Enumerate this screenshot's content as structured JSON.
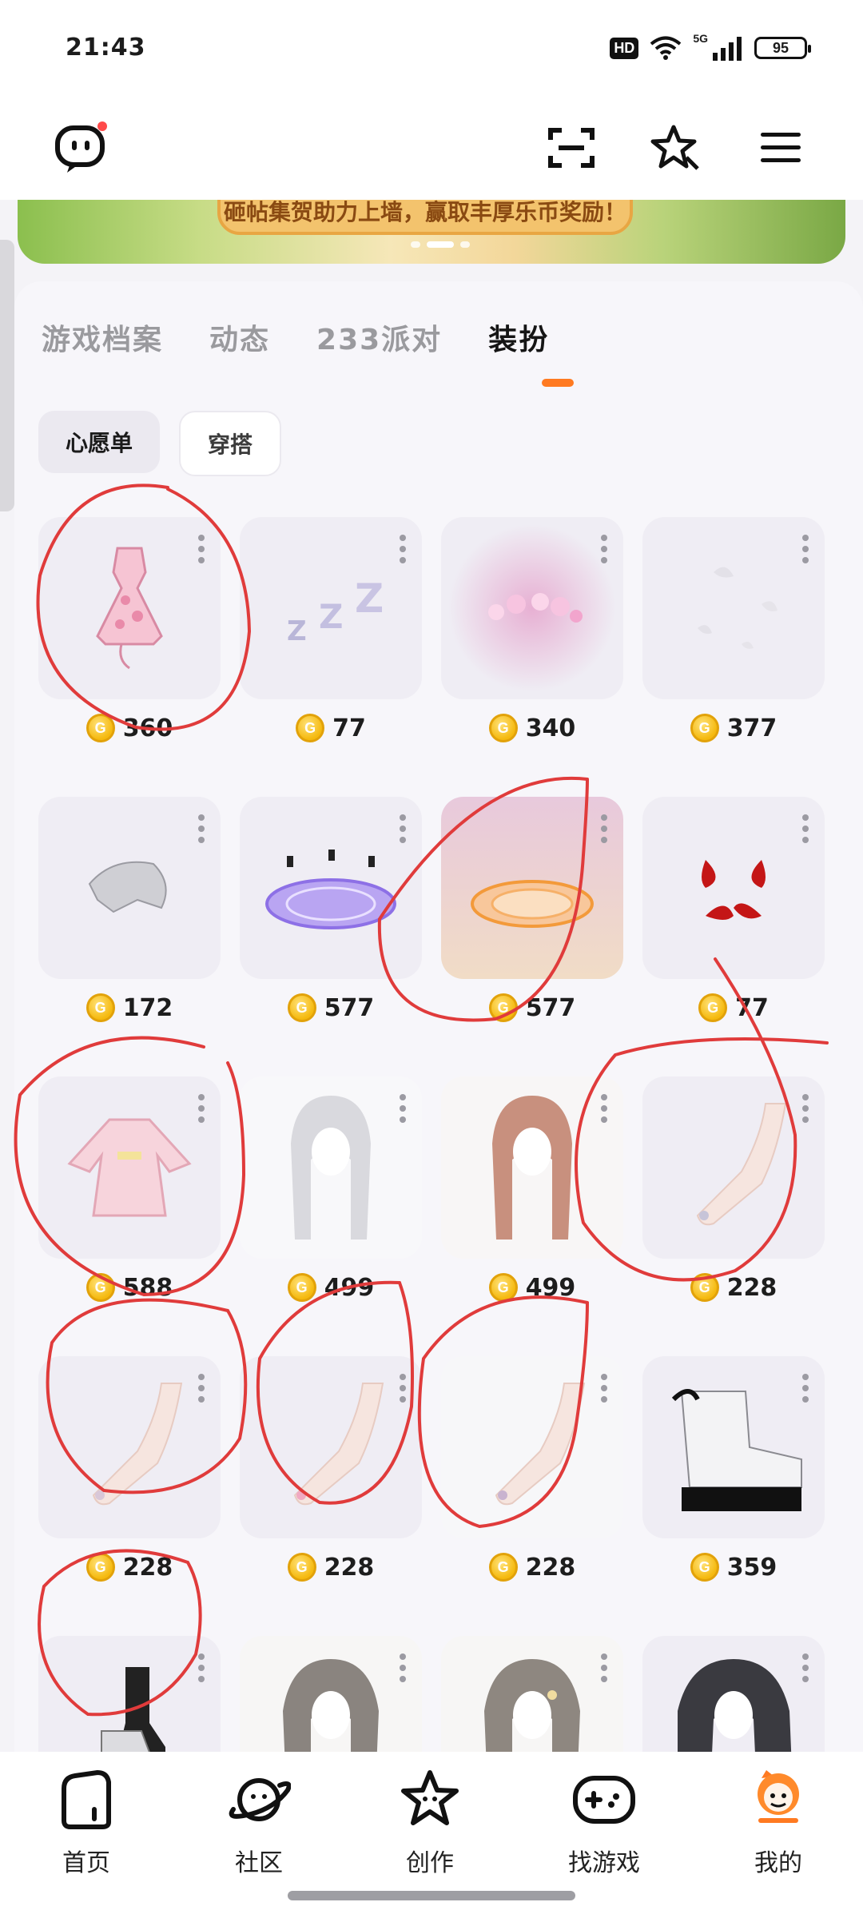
{
  "status_bar": {
    "time": "21:43",
    "hd": "HD",
    "network": "5G",
    "battery": "95"
  },
  "top_bar": {
    "icons": [
      "chat-logo-icon",
      "scan-icon",
      "star-sparkle-icon",
      "menu-icon"
    ]
  },
  "banner": {
    "text": "砸帖集贺助力上墙，赢取丰厚乐币奖励！"
  },
  "tabs": [
    {
      "label": "游戏档案",
      "active": false
    },
    {
      "label": "动态",
      "active": false
    },
    {
      "label": "233派对",
      "active": false
    },
    {
      "label": "装扮",
      "active": true
    }
  ],
  "chips": [
    {
      "label": "心愿单",
      "selected": true
    },
    {
      "label": "穿搭",
      "selected": false
    }
  ],
  "items": [
    {
      "name": "pink-dress",
      "price": "360"
    },
    {
      "name": "zzz-effect",
      "price": "77"
    },
    {
      "name": "pink-flower-halo",
      "price": "340"
    },
    {
      "name": "white-petals-effect",
      "price": "377"
    },
    {
      "name": "lace-headscarf",
      "price": "172"
    },
    {
      "name": "purple-magic-circle",
      "price": "577"
    },
    {
      "name": "orange-magic-circle",
      "price": "577"
    },
    {
      "name": "anger-mark",
      "price": "77"
    },
    {
      "name": "pink-kimono-dress",
      "price": "588"
    },
    {
      "name": "silver-long-hair",
      "price": "499"
    },
    {
      "name": "brown-long-hair",
      "price": "499"
    },
    {
      "name": "manicure-hand-1",
      "price": "228"
    },
    {
      "name": "manicure-hand-2",
      "price": "228"
    },
    {
      "name": "manicure-hand-3",
      "price": "228"
    },
    {
      "name": "manicure-hand-4",
      "price": "228"
    },
    {
      "name": "white-platform-boots",
      "price": "359"
    },
    {
      "name": "black-white-socks",
      "price": ""
    },
    {
      "name": "ash-brown-hair-1",
      "price": ""
    },
    {
      "name": "ash-brown-hair-2",
      "price": ""
    },
    {
      "name": "black-long-hair",
      "price": ""
    }
  ],
  "bottom_nav": [
    {
      "label": "首页",
      "icon": "home-icon"
    },
    {
      "label": "社区",
      "icon": "planet-icon"
    },
    {
      "label": "创作",
      "icon": "star-face-icon"
    },
    {
      "label": "找游戏",
      "icon": "gamepad-icon"
    },
    {
      "label": "我的",
      "icon": "profile-icon"
    }
  ],
  "colors": {
    "accent": "#ff7a21",
    "coin": "#f5b90e",
    "annotation": "#e03b3b"
  }
}
